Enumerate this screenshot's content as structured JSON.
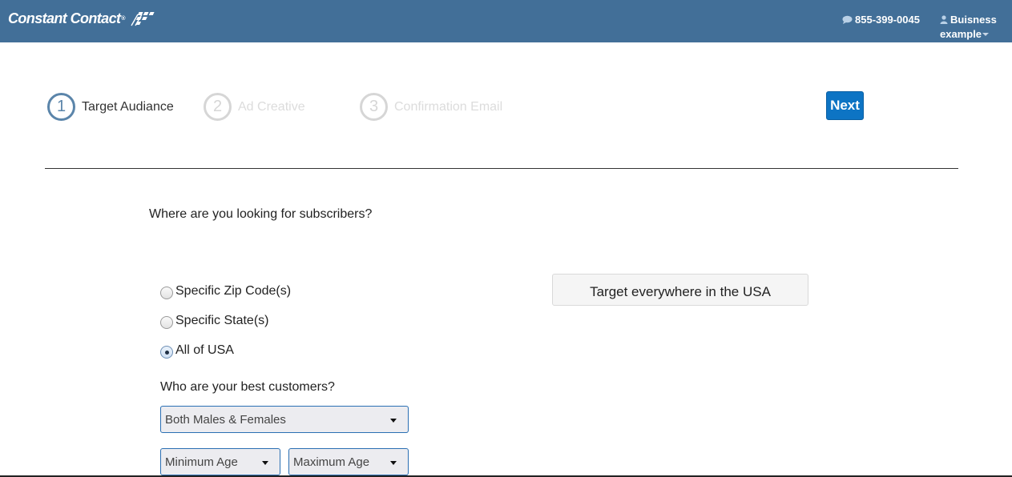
{
  "header": {
    "brand": "Constant Contact",
    "brand_mark": "®",
    "phone_icon": "chat-bubble-icon",
    "phone": "855-399-0045",
    "user_icon": "user-icon",
    "user_name_line1": "Buisness",
    "user_name_line2": "example",
    "bar_color": "#426f98"
  },
  "steps": [
    {
      "number": "1",
      "label": "Target Audiance",
      "state": "active"
    },
    {
      "number": "2",
      "label": "Ad Creative",
      "state": "inactive"
    },
    {
      "number": "3",
      "label": "Confirmation Email",
      "state": "inactive"
    }
  ],
  "next_button": {
    "label": "Next",
    "color": "#0d74c4"
  },
  "location": {
    "question": "Where are you looking for subscribers?",
    "options": [
      {
        "label": "Specific Zip Code(s)",
        "checked": false
      },
      {
        "label": "Specific State(s)",
        "checked": false
      },
      {
        "label": "All of USA",
        "checked": true
      }
    ],
    "target_button": "Target everywhere in the USA"
  },
  "customers": {
    "question": "Who are your best customers?",
    "gender_select": "Both Males & Females",
    "min_age_select": "Minimum Age",
    "max_age_select": "Maximum Age"
  }
}
